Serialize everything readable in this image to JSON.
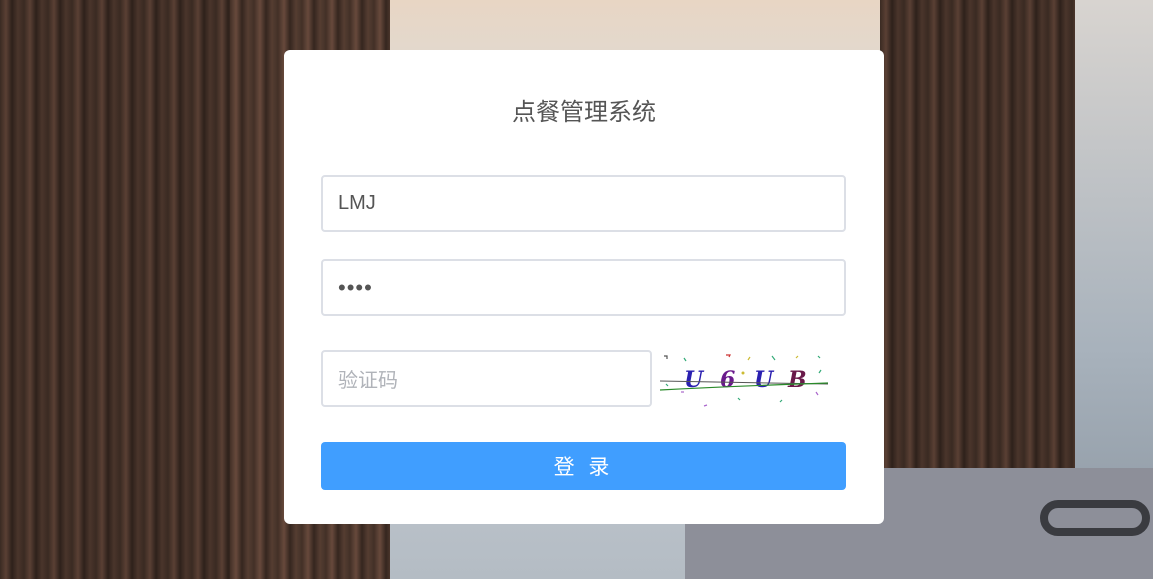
{
  "login": {
    "title": "点餐管理系统",
    "username_value": "LMJ",
    "password_value": "••••",
    "captcha_placeholder": "验证码",
    "captcha_text": [
      "U",
      "6",
      "U",
      "B"
    ],
    "submit_label": "登 录"
  },
  "colors": {
    "primary": "#409eff",
    "card": "#ffffff",
    "border": "#dcdfe6",
    "captcha_chars": [
      "#2a1fb0",
      "#6a1a8c",
      "#2a1fb0",
      "#6a1a4a"
    ]
  }
}
